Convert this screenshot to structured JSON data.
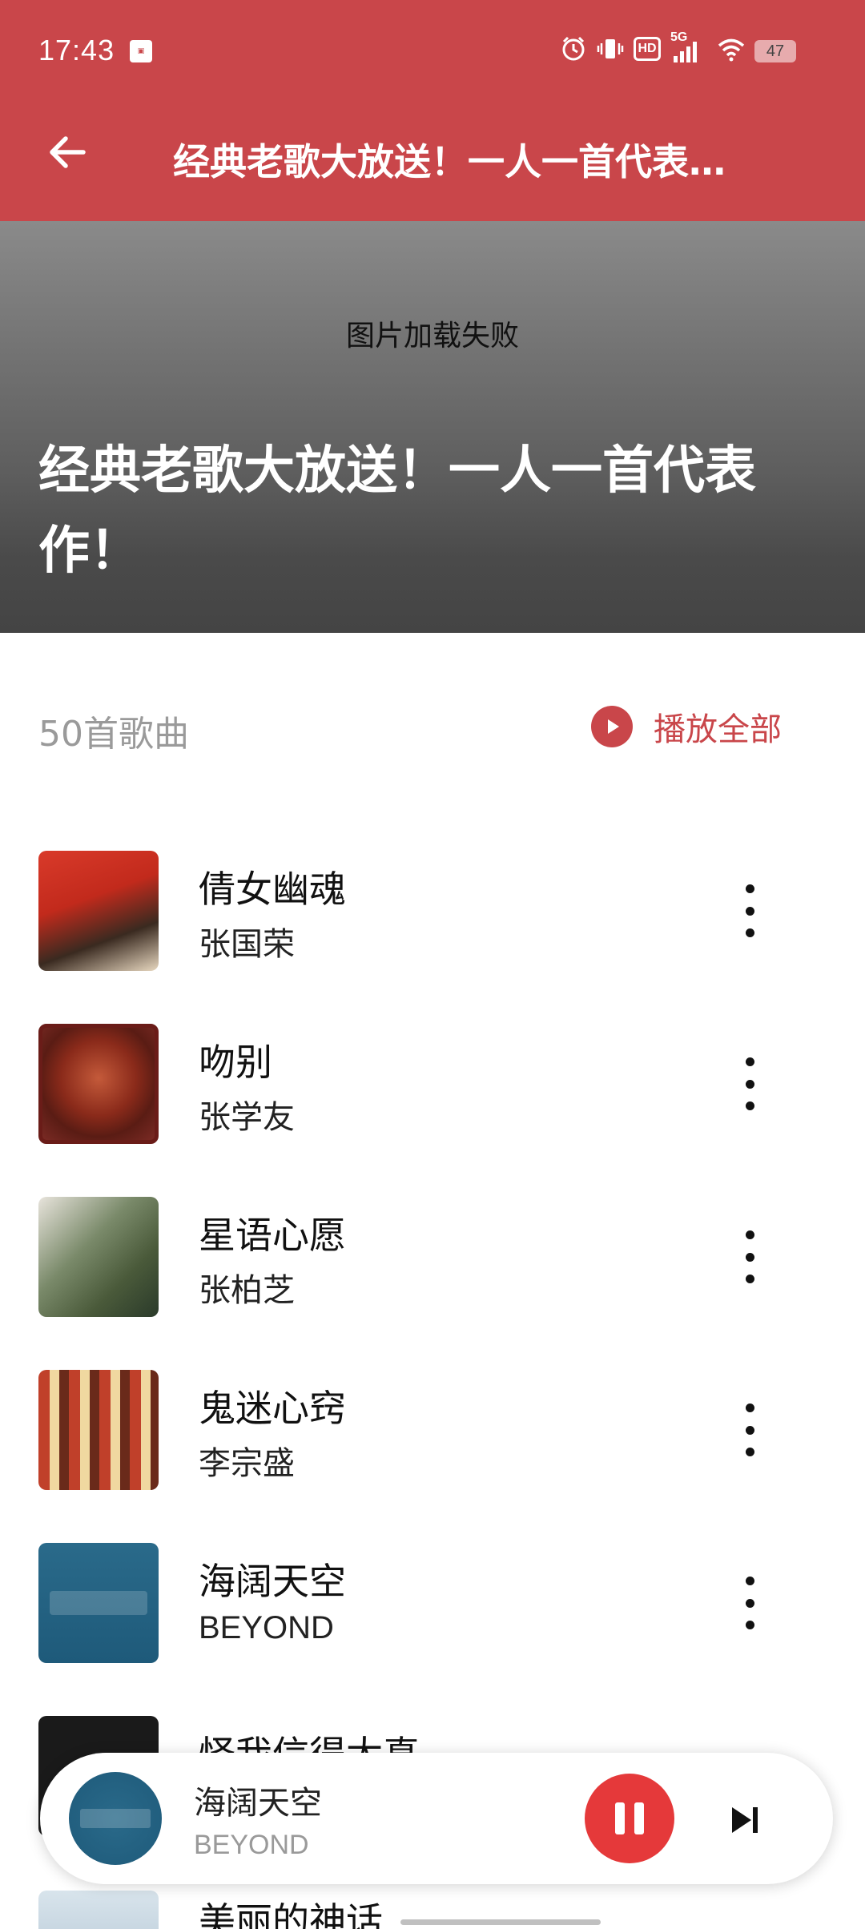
{
  "status_bar": {
    "time": "17:43",
    "battery": "47",
    "network": "5G",
    "hd_label": "HD"
  },
  "appbar": {
    "title": "经典老歌大放送！一人一首代表…"
  },
  "hero": {
    "image_error": "图片加载失败",
    "title": "经典老歌大放送！一人一首代表作！"
  },
  "summary": {
    "count_label": "50首歌曲",
    "play_all_label": "播放全部"
  },
  "songs": [
    {
      "title": "倩女幽魂",
      "artist": "张国荣"
    },
    {
      "title": "吻别",
      "artist": "张学友"
    },
    {
      "title": "星语心愿",
      "artist": "张柏芝"
    },
    {
      "title": "鬼迷心窍",
      "artist": "李宗盛"
    },
    {
      "title": "海阔天空",
      "artist": "BEYOND"
    },
    {
      "title": "怪我信得太真",
      "artist": ""
    },
    {
      "title": "美丽的神话",
      "artist": ""
    }
  ],
  "player": {
    "title": "海阔天空",
    "artist": "BEYOND"
  },
  "colors": {
    "accent": "#c9464a",
    "pause_button": "#e5393a"
  }
}
